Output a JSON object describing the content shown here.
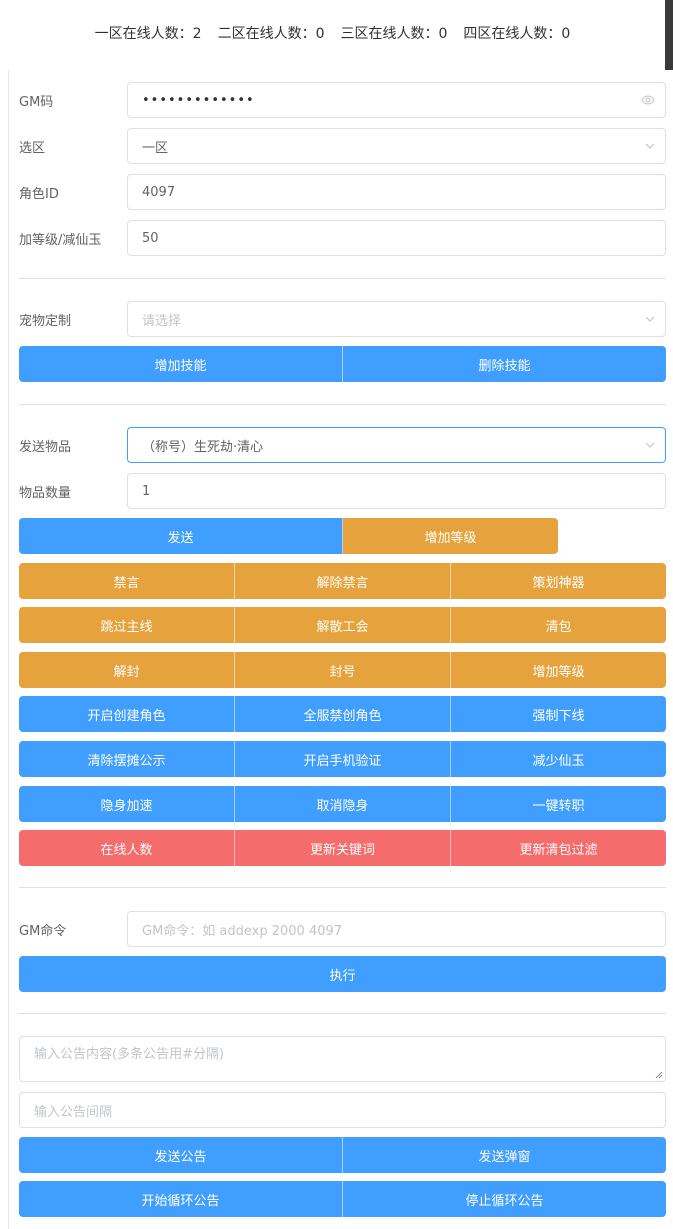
{
  "header": {
    "zone1": "一区在线人数：2",
    "zone2": "二区在线人数：0",
    "zone3": "三区在线人数：0",
    "zone4": "四区在线人数：0"
  },
  "form": {
    "gm_code": {
      "label": "GM码",
      "value": "•••••••••••••"
    },
    "zone": {
      "label": "选区",
      "value": "一区"
    },
    "role_id": {
      "label": "角色ID",
      "value": "4097"
    },
    "level_jade": {
      "label": "加等级/减仙玉",
      "value": "50"
    },
    "pet": {
      "label": "宠物定制",
      "placeholder": "请选择"
    },
    "item": {
      "label": "发送物品",
      "value": "（称号）生死劫·清心"
    },
    "quantity": {
      "label": "物品数量",
      "value": "1"
    },
    "gm_command": {
      "label": "GM命令",
      "placeholder": "GM命令：如 addexp 2000 4097"
    },
    "notice_content": {
      "placeholder": "输入公告内容(多条公告用#分隔)"
    },
    "notice_interval": {
      "placeholder": "输入公告间隔"
    }
  },
  "buttons": {
    "add_skill": "增加技能",
    "delete_skill": "删除技能",
    "send": "发送",
    "add_level_1": "增加等级",
    "row1": [
      "禁言",
      "解除禁言",
      "策划神器"
    ],
    "row2": [
      "跳过主线",
      "解散工会",
      "清包"
    ],
    "row3": [
      "解封",
      "封号",
      "增加等级"
    ],
    "row4": [
      "开启创建角色",
      "全服禁创角色",
      "强制下线"
    ],
    "row5": [
      "清除摆摊公示",
      "开启手机验证",
      "减少仙玉"
    ],
    "row6": [
      "隐身加速",
      "取消隐身",
      "一键转职"
    ],
    "row7": [
      "在线人数",
      "更新关键词",
      "更新清包过滤"
    ],
    "execute": "执行",
    "send_notice": "发送公告",
    "send_popup": "发送弹窗",
    "start_loop": "开始循环公告",
    "stop_loop": "停止循环公告"
  },
  "colors": {
    "primary": "#409eff",
    "warning": "#e6a23c",
    "danger": "#f56c6c"
  }
}
